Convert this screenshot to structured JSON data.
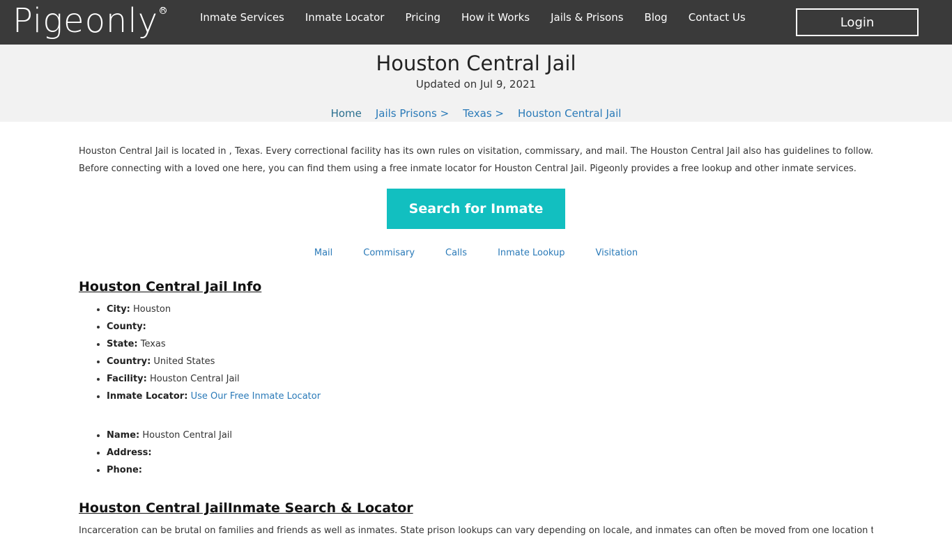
{
  "navbar": {
    "logo": "Pigeonly",
    "logo_mark": "R",
    "links": [
      "Inmate Services",
      "Inmate Locator",
      "Pricing",
      "How it Works",
      "Jails & Prisons",
      "Blog",
      "Contact Us"
    ],
    "login_label": "Login"
  },
  "hero": {
    "title": "Houston Central Jail",
    "updated": "Updated on Jul 9, 2021",
    "breadcrumb": [
      "Home",
      "Jails Prisons >",
      "Texas >",
      "Houston Central Jail"
    ]
  },
  "intro": "Houston Central Jail is located in , Texas. Every correctional facility has its own rules on visitation, commissary, and mail. The Houston Central Jail also has guidelines to follow. Before connecting with a loved one here, you can find them using a free inmate locator for Houston Central Jail. Pigeonly provides a free lookup and other inmate services.",
  "search_button": "Search for Inmate",
  "subnav": [
    "Mail",
    "Commisary",
    "Calls",
    "Inmate Lookup",
    "Visitation"
  ],
  "info_section": {
    "title": "Houston Central Jail Info",
    "list1": [
      {
        "key": "City:",
        "value": "Houston"
      },
      {
        "key": "County:",
        "value": ""
      },
      {
        "key": "State:",
        "value": "Texas"
      },
      {
        "key": "Country:",
        "value": "United States"
      },
      {
        "key": "Facility:",
        "value": "Houston Central Jail"
      },
      {
        "key": "Inmate Locator:",
        "value": "Use Our Free Inmate Locator"
      }
    ],
    "list2": [
      {
        "key": "Name:",
        "value": "Houston Central Jail"
      },
      {
        "key": "Address:",
        "value": ""
      },
      {
        "key": "Phone:",
        "value": ""
      }
    ]
  },
  "search_section": {
    "title": "Houston Central JailInmate Search & Locator",
    "text": "Incarceration can be brutal on families and friends as well as inmates. State prison lookups can vary depending on locale, and inmates can often be moved from one location to another"
  }
}
